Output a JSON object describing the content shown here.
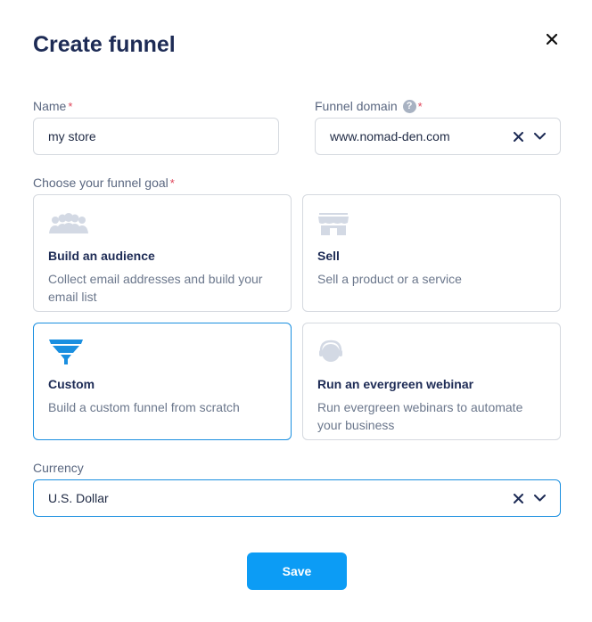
{
  "dialog": {
    "title": "Create funnel"
  },
  "name": {
    "label": "Name",
    "required_mark": "*",
    "value": "my store"
  },
  "domain": {
    "label": "Funnel domain",
    "help": "?",
    "required_mark": "*",
    "value": "www.nomad-den.com"
  },
  "goal": {
    "label": "Choose your funnel goal",
    "required_mark": "*",
    "options": [
      {
        "title": "Build an audience",
        "description": "Collect email addresses and build your email list",
        "icon": "audience-icon",
        "selected": false
      },
      {
        "title": "Sell",
        "description": "Sell a product or a service",
        "icon": "store-icon",
        "selected": false
      },
      {
        "title": "Custom",
        "description": "Build a custom funnel from scratch",
        "icon": "funnel-icon",
        "selected": true
      },
      {
        "title": "Run an evergreen webinar",
        "description": "Run evergreen webinars to automate your business",
        "icon": "webinar-icon",
        "selected": false
      }
    ]
  },
  "currency": {
    "label": "Currency",
    "value": "U.S. Dollar"
  },
  "actions": {
    "save_label": "Save"
  },
  "colors": {
    "accent": "#0c9cf5",
    "selected_border": "#1a8fe0",
    "title": "#1d2b55",
    "required": "#e0455a",
    "icon_muted": "#d3d9e4"
  }
}
